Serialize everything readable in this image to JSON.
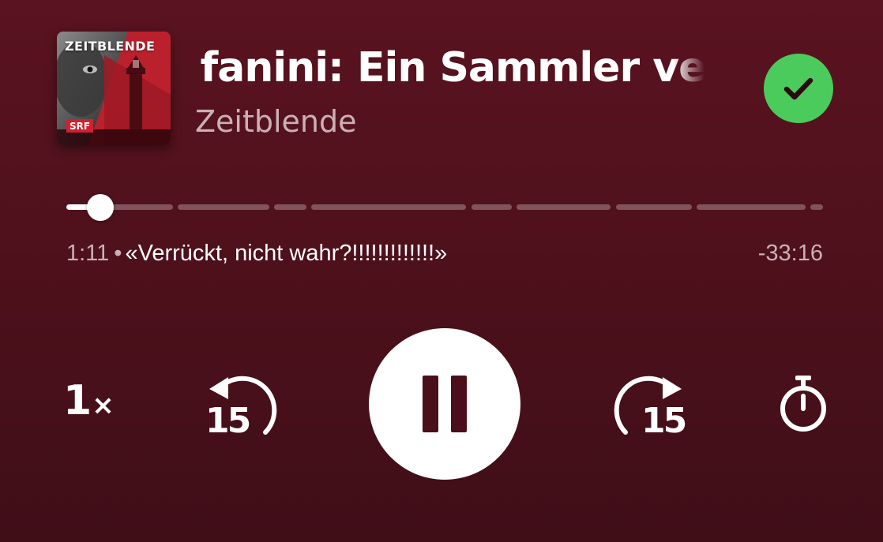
{
  "podcast": {
    "cover_title": "ZEITBLENDE",
    "cover_badge": "SRF",
    "episode_title": "fanini: Ein Sammler ver",
    "show_name": "Zeitblende",
    "saved_icon": "check-icon",
    "saved_color": "#4ccb5d"
  },
  "playback": {
    "elapsed": "1:11",
    "separator": "•",
    "chapter_title": "«Verrückt, nicht wahr?!!!!!!!!!!!!!»",
    "remaining": "-33:16",
    "progress_fraction": 0.034
  },
  "controls": {
    "speed_value": "1",
    "speed_suffix": "×",
    "rewind_seconds": "15",
    "forward_seconds": "15",
    "play_state": "playing",
    "play_icon": "pause-icon",
    "timer_icon": "sleep-timer-icon"
  },
  "colors": {
    "background": "#4f111c",
    "accent": "#4ccb5d"
  }
}
